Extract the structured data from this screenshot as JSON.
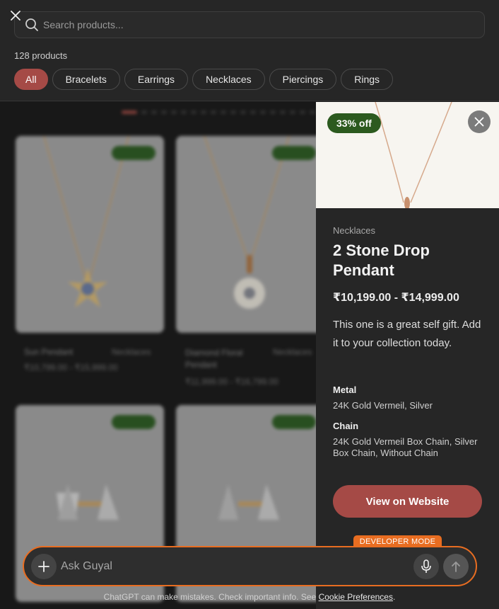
{
  "search": {
    "placeholder": "Search products..."
  },
  "results": {
    "count_label": "128 products"
  },
  "filters": [
    {
      "label": "All",
      "active": true
    },
    {
      "label": "Bracelets"
    },
    {
      "label": "Earrings"
    },
    {
      "label": "Necklaces"
    },
    {
      "label": "Piercings"
    },
    {
      "label": "Rings"
    }
  ],
  "grid": {
    "cards": [
      {
        "name": "Sun Pendant",
        "category": "Necklaces",
        "price": "₹10,799.00 - ₹15,999.00"
      },
      {
        "name": "Diamond Floral Pendant",
        "category": "Necklaces",
        "price": "₹11,999.00 - ₹16,799.00"
      }
    ]
  },
  "detail": {
    "discount": "33% off",
    "category": "Necklaces",
    "title": "2 Stone Drop Pendant",
    "price": "₹10,199.00 - ₹14,999.00",
    "description": "This one is a great self gift. Add it to your collection today.",
    "attributes": [
      {
        "label": "Metal",
        "value": "24K Gold Vermeil, Silver"
      },
      {
        "label": "Chain",
        "value": "24K Gold Vermeil Box Chain, Silver Box Chain, Without Chain"
      }
    ],
    "cta": "View on Website"
  },
  "composer": {
    "badge": "DEVELOPER MODE",
    "placeholder": "Ask Guyal"
  },
  "footer": {
    "text": "ChatGPT can make mistakes. Check important info. See ",
    "link": "Cookie Preferences",
    "end": "."
  },
  "colors": {
    "accent": "#a54a46",
    "badge_green": "#2c5a1f",
    "dev_orange": "#e86d21"
  }
}
